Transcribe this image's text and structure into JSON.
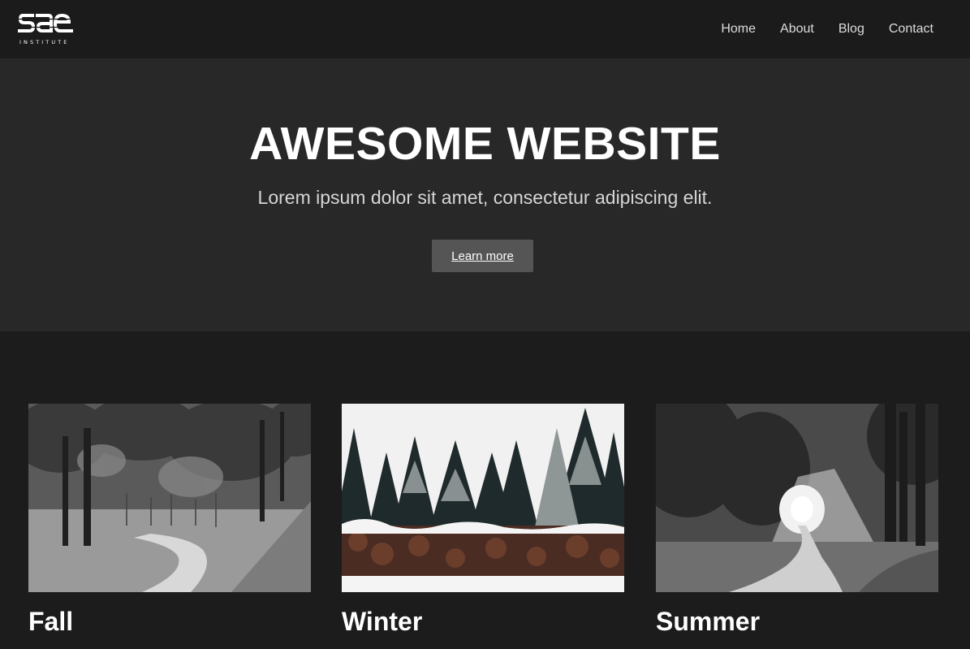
{
  "brand": {
    "logo_text": "sae",
    "logo_sub": "INSTITUTE"
  },
  "nav": {
    "items": [
      {
        "label": "Home"
      },
      {
        "label": "About"
      },
      {
        "label": "Blog"
      },
      {
        "label": "Contact"
      }
    ]
  },
  "hero": {
    "title": "AWESOME WEBSITE",
    "subtitle": "Lorem ipsum dolor sit amet, consectetur adipiscing elit.",
    "button_label": "Learn more"
  },
  "cards": [
    {
      "title": "Fall",
      "image": "forest-path-image"
    },
    {
      "title": "Winter",
      "image": "snowy-pines-woodpile-image"
    },
    {
      "title": "Summer",
      "image": "sunlit-forest-path-image"
    }
  ],
  "colors": {
    "navbar_bg": "#1b1b1b",
    "hero_bg": "#282828",
    "page_bg": "#1c1c1c",
    "button_bg": "#555555",
    "text": "#ffffff"
  }
}
